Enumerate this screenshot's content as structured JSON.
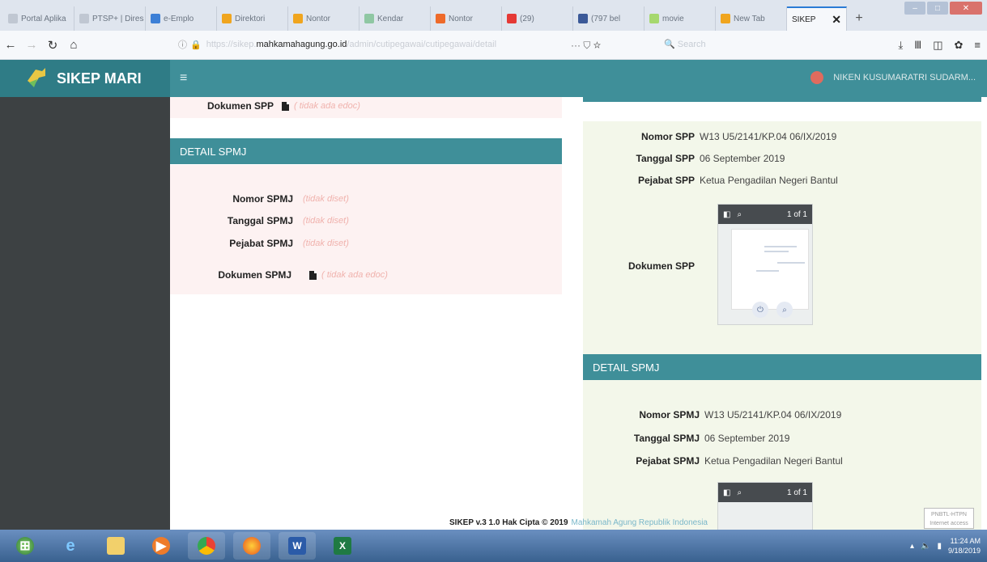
{
  "browser": {
    "tabs": [
      {
        "label": "Portal Aplika",
        "color": "#c0c7d2"
      },
      {
        "label": "PTSP+ | Dires",
        "color": "#c0c7d2"
      },
      {
        "label": "e-Emplo",
        "color": "#3c7fd6"
      },
      {
        "label": "Direktori",
        "color": "#f0a51e"
      },
      {
        "label": "Nontor",
        "color": "#f0a51e"
      },
      {
        "label": "Kendar",
        "color": "#8fc7a3"
      },
      {
        "label": "Nontor",
        "color": "#ee6a2a"
      },
      {
        "label": "(29)",
        "color": "#e53935"
      },
      {
        "label": "(797 bel",
        "color": "#3b5998"
      },
      {
        "label": "movie",
        "color": "#a6d86e"
      },
      {
        "label": "New Tab",
        "color": "#f0a51e"
      }
    ],
    "active_tab": {
      "label": "SIKEP",
      "close": "✕"
    },
    "new_tab": "+",
    "url": {
      "host": "mahkamahagung.go.id",
      "prefix": "https://sikep.",
      "path": "/admin/cutipegawai/cutipegawai/detail"
    },
    "search_placeholder": "Search",
    "page_actions": "··· ⛉ ☆"
  },
  "app": {
    "brand": "SIKEP MARI",
    "menu_icon": "≡",
    "user_name": "NIKEN KUSUMARATRI SUDARM..."
  },
  "left": {
    "top_row": {
      "label": "Dokumen SPP",
      "value": "( tidak ada edoc)"
    },
    "section_title": "DETAIL SPMJ",
    "fields": [
      {
        "label": "Nomor SPMJ",
        "value": "(tidak diset)"
      },
      {
        "label": "Tanggal SPMJ",
        "value": "(tidak diset)"
      },
      {
        "label": "Pejabat SPMJ",
        "value": "(tidak diset)"
      }
    ],
    "doc": {
      "label": "Dokumen SPMJ",
      "value": "( tidak ada edoc)"
    }
  },
  "right": {
    "spp_fields": [
      {
        "label": "Nomor SPP",
        "value": "W13 U5/2141/KP.04 06/IX/2019"
      },
      {
        "label": "Tanggal SPP",
        "value": "06 September 2019"
      },
      {
        "label": "Pejabat SPP",
        "value": "Ketua Pengadilan Negeri Bantul"
      }
    ],
    "spp_doc_label": "Dokumen SPP",
    "section_title": "DETAIL SPMJ",
    "spmj_fields": [
      {
        "label": "Nomor SPMJ",
        "value": "W13 U5/2141/KP.04 06/IX/2019"
      },
      {
        "label": "Tanggal SPMJ",
        "value": "06 September 2019"
      },
      {
        "label": "Pejabat SPMJ",
        "value": "Ketua Pengadilan Negeri Bantul"
      }
    ],
    "pdf": {
      "page": "1",
      "of": "of 1"
    }
  },
  "footer": {
    "text": "SIKEP v.3 1.0 Hak Cipta © 2019",
    "org": "Mahkamah Agung Republik Indonesia"
  },
  "watermark": "PNBTL-HTPN Internet access",
  "taskbar": {
    "clock_time": "11:24 AM",
    "clock_date": "9/18/2019"
  }
}
